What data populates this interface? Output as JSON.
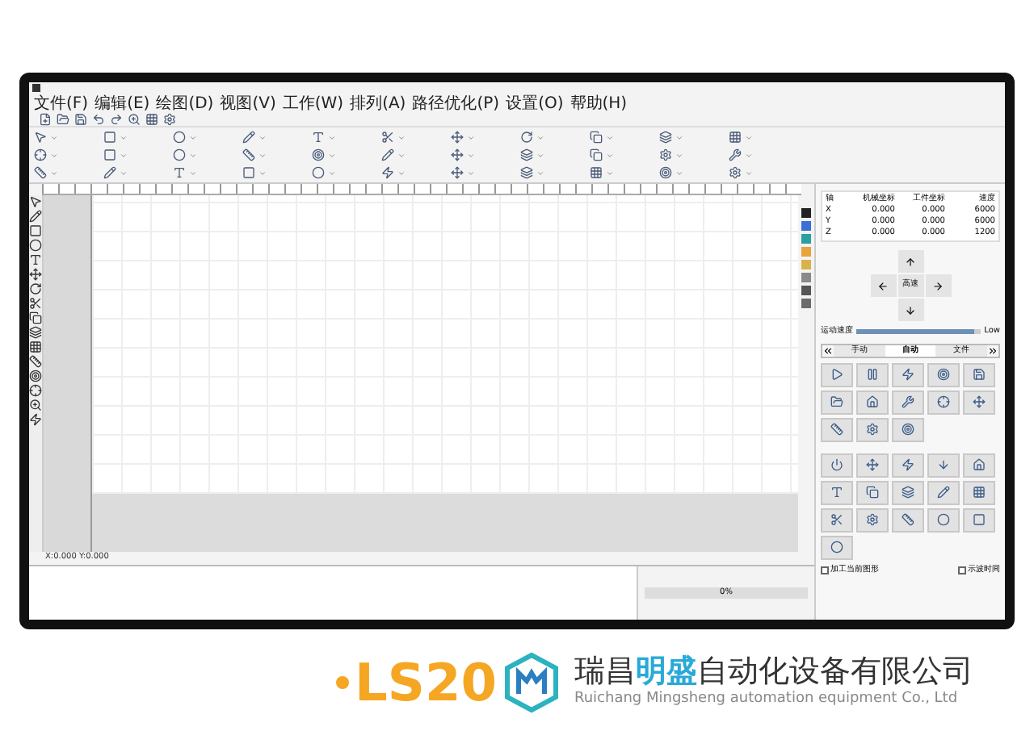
{
  "menu": [
    "文件(F)",
    "编辑(E)",
    "绘图(D)",
    "视图(V)",
    "工作(W)",
    "排列(A)",
    "路径优化(P)",
    "设置(O)",
    "帮助(H)"
  ],
  "axes": {
    "columns": [
      "轴",
      "机械坐标",
      "工件坐标",
      "速度"
    ],
    "rows": [
      {
        "axis": "X",
        "machine": "0.000",
        "work": "0.000",
        "speed": "6000"
      },
      {
        "axis": "Y",
        "machine": "0.000",
        "work": "0.000",
        "speed": "6000"
      },
      {
        "axis": "Z",
        "machine": "0.000",
        "work": "0.000",
        "speed": "1200"
      }
    ]
  },
  "jog": {
    "center": "高速"
  },
  "speed_slider": {
    "label": "运动速度",
    "level": 0.95,
    "reading": "Low"
  },
  "panel_tabs": [
    {
      "label": "手动",
      "selected": false
    },
    {
      "label": "自动",
      "selected": true
    },
    {
      "label": "文件",
      "selected": false
    }
  ],
  "options": [
    {
      "label": "加工当前图形",
      "checked": false
    },
    {
      "label": "示波时间",
      "checked": false
    }
  ],
  "palette": [
    {
      "color": "#222222"
    },
    {
      "color": "#3a6fd8"
    },
    {
      "color": "#2aa0a0"
    },
    {
      "color": "#e8a33a"
    },
    {
      "color": "#d9b24a"
    },
    {
      "color": "#8a8a8a"
    },
    {
      "color": "#555555"
    },
    {
      "color": "#6b6b6b"
    }
  ],
  "progress": {
    "level": 0,
    "reading": "0%"
  },
  "coords": "X:0.000 Y:0.000",
  "brand": {
    "model": "LS20",
    "name_a": "瑞昌",
    "name_b": "明盛",
    "name_c": "自动化设备有限公司",
    "tagline": "Ruichang Mingsheng automation equipment Co., Ltd"
  }
}
